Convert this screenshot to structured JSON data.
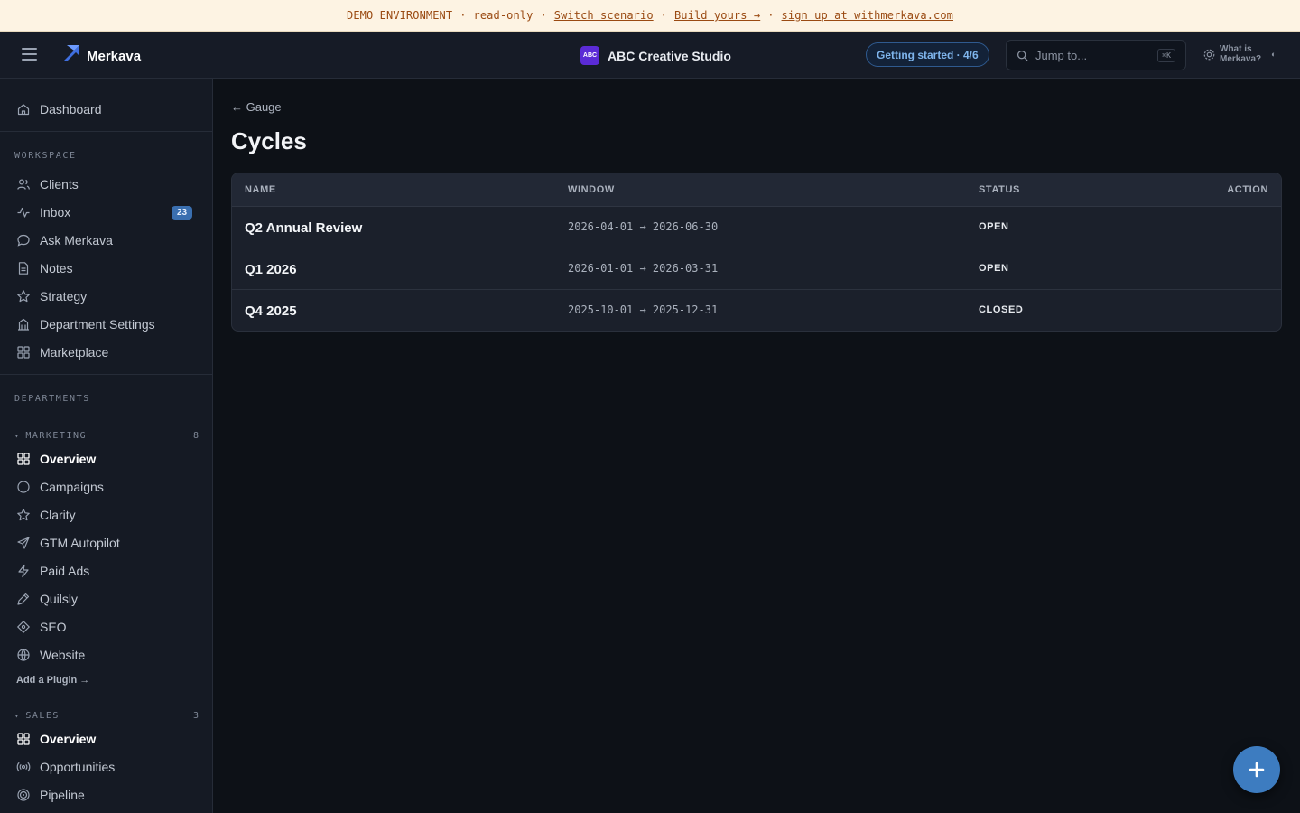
{
  "banner": {
    "env": "DEMO ENVIRONMENT",
    "sep": "·",
    "mode": "read-only",
    "switch_link": "Switch scenario",
    "build_link": "Build yours →",
    "signup_link": "sign up at withmerkava.com"
  },
  "topbar": {
    "app_name": "Merkava",
    "workspace_avatar": "ABC",
    "workspace_name": "ABC Creative Studio",
    "getting_started": "Getting started · 4/6",
    "search_placeholder": "Jump to...",
    "search_shortcut": "⌘K",
    "what_is": "What is Merkava?",
    "theme_toggle": "◐"
  },
  "sidebar": {
    "dashboard": "Dashboard",
    "workspace_label": "WORKSPACE",
    "workspace_items": [
      {
        "label": "Clients",
        "icon": "users-icon"
      },
      {
        "label": "Inbox",
        "icon": "activity-icon",
        "badge": "23"
      },
      {
        "label": "Ask Merkava",
        "icon": "chat-icon"
      },
      {
        "label": "Notes",
        "icon": "document-icon"
      },
      {
        "label": "Strategy",
        "icon": "star-icon"
      },
      {
        "label": "Department Settings",
        "icon": "building-icon"
      },
      {
        "label": "Marketplace",
        "icon": "grid-icon"
      }
    ],
    "departments_label": "DEPARTMENTS",
    "marketing": {
      "label": "MARKETING",
      "count": "8",
      "items": [
        {
          "label": "Overview",
          "icon": "grid-icon"
        },
        {
          "label": "Campaigns",
          "icon": "circle-icon"
        },
        {
          "label": "Clarity",
          "icon": "star-icon"
        },
        {
          "label": "GTM Autopilot",
          "icon": "send-icon"
        },
        {
          "label": "Paid Ads",
          "icon": "lightning-icon"
        },
        {
          "label": "Quilsly",
          "icon": "pen-icon"
        },
        {
          "label": "SEO",
          "icon": "diamond-icon"
        },
        {
          "label": "Website",
          "icon": "globe-icon"
        }
      ]
    },
    "add_plugin": "Add a Plugin →",
    "sales": {
      "label": "SALES",
      "count": "3",
      "items": [
        {
          "label": "Overview",
          "icon": "grid-icon"
        },
        {
          "label": "Opportunities",
          "icon": "broadcast-icon"
        },
        {
          "label": "Pipeline",
          "icon": "target-icon"
        }
      ]
    }
  },
  "main": {
    "back_label": "← Gauge",
    "title": "Cycles",
    "columns": [
      "NAME",
      "WINDOW",
      "STATUS",
      "ACTION"
    ],
    "rows": [
      {
        "name": "Q2 Annual Review",
        "window": "2026-04-01 → 2026-06-30",
        "status": "OPEN"
      },
      {
        "name": "Q1 2026",
        "window": "2026-01-01 → 2026-03-31",
        "status": "OPEN"
      },
      {
        "name": "Q4 2025",
        "window": "2025-10-01 → 2025-12-31",
        "status": "CLOSED"
      }
    ]
  },
  "fab_icon": "plus-icon"
}
